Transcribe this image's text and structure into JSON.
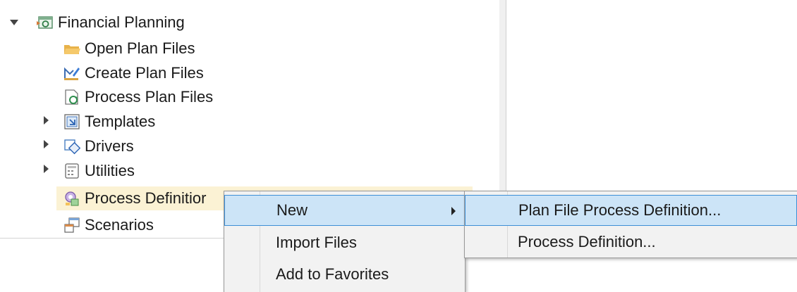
{
  "tree": {
    "root": {
      "label": "Financial Planning",
      "icon": "financial-planning-icon",
      "expanded": true
    },
    "items": [
      {
        "label": "Open Plan Files",
        "icon": "folder-open-icon",
        "expandable": false
      },
      {
        "label": "Create Plan Files",
        "icon": "create-plan-icon",
        "expandable": false
      },
      {
        "label": "Process Plan Files",
        "icon": "process-plan-icon",
        "expandable": false
      },
      {
        "label": "Templates",
        "icon": "templates-icon",
        "expandable": true
      },
      {
        "label": "Drivers",
        "icon": "drivers-icon",
        "expandable": true
      },
      {
        "label": "Utilities",
        "icon": "utilities-icon",
        "expandable": true
      },
      {
        "label": "Process Definitior",
        "icon": "process-definition-icon",
        "expandable": false,
        "selected": true
      },
      {
        "label": "Scenarios",
        "icon": "scenarios-icon",
        "expandable": false
      }
    ]
  },
  "context_menu": {
    "items": [
      {
        "label": "New",
        "has_submenu": true,
        "highlighted": true
      },
      {
        "label": "Import Files"
      },
      {
        "label": "Add to Favorites"
      }
    ]
  },
  "submenu": {
    "items": [
      {
        "label": "Plan File Process Definition...",
        "highlighted": true
      },
      {
        "label": "Process Definition..."
      }
    ]
  },
  "colors": {
    "selection": "#fbf2d4",
    "menu_background": "#f2f2f2",
    "menu_highlight": "#cce4f7",
    "menu_highlight_border": "#3d8fd6"
  }
}
